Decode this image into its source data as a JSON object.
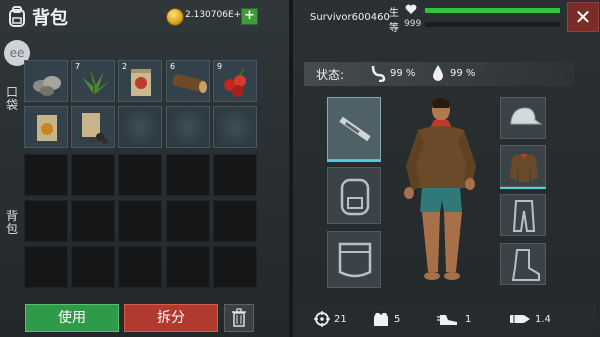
{
  "inventory": {
    "title": "背包",
    "currency_value": "2.130706E+09",
    "add_label": "+",
    "tabs": {
      "pocket": "口袋",
      "backpack": "背包"
    },
    "avatar_text": "ee",
    "pocket_items": [
      {
        "name": "stones",
        "count": ""
      },
      {
        "name": "herb-leaves",
        "count": "7"
      },
      {
        "name": "seed-packet",
        "count": "2"
      },
      {
        "name": "wood-log",
        "count": "6"
      },
      {
        "name": "berries",
        "count": "9"
      },
      {
        "name": "seed-bag-orange",
        "count": ""
      },
      {
        "name": "seed-bag-dark",
        "count": ""
      },
      {
        "name": "empty",
        "count": ""
      },
      {
        "name": "empty",
        "count": ""
      },
      {
        "name": "empty",
        "count": ""
      }
    ],
    "use_label": "使用",
    "split_label": "拆分"
  },
  "character": {
    "name": "Survivor600460",
    "health_label": "生",
    "level_label": "等",
    "level_value": "999",
    "health_fraction": 1.0,
    "xp_fraction": 0.0,
    "status_label": "状态:",
    "hunger": "99 %",
    "thirst": "99 %",
    "equipment": [
      "weapon-rifle",
      "backpack",
      "pocket-pouch",
      "cap",
      "jacket",
      "pants",
      "boots"
    ],
    "stats": {
      "attack": "21",
      "armor": "5",
      "speed": "1",
      "bullets": "1.4"
    }
  },
  "colors": {
    "accent_green": "#2f9a4a",
    "accent_red": "#b13a2e",
    "health_green": "#33c43c",
    "equip_highlight": "#4fd0d8"
  }
}
